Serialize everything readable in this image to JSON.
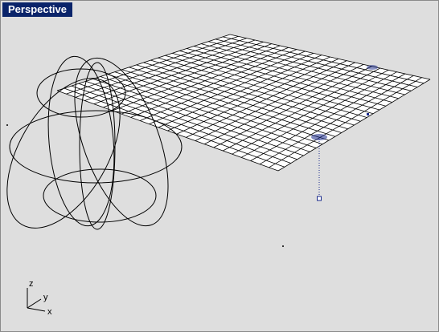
{
  "viewport": {
    "title": "Perspective",
    "background": "#dedede",
    "tab_color": "#0a246a",
    "wire_color": "#000000",
    "selection_color": "#1a2a8c"
  },
  "axes_widget": {
    "z_label": "z",
    "y_label": "y",
    "x_label": "x"
  },
  "scene": {
    "objects": [
      "sphere-wireframe",
      "surface-grid",
      "control-point"
    ]
  }
}
